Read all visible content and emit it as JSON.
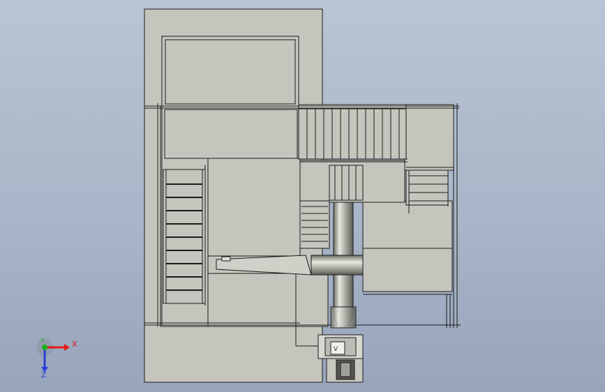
{
  "viewport": {
    "background_top": "#b9c4d4",
    "background_bottom": "#97a4ba",
    "part_fill": "#c5c5bd",
    "edge_color": "#1a1a1a"
  },
  "triad": {
    "x_label": "X",
    "y_label": "Y",
    "z_label": "Z",
    "x_color": "#e01b1b",
    "y_color": "#1bb01b",
    "z_color": "#2a3fd6"
  }
}
